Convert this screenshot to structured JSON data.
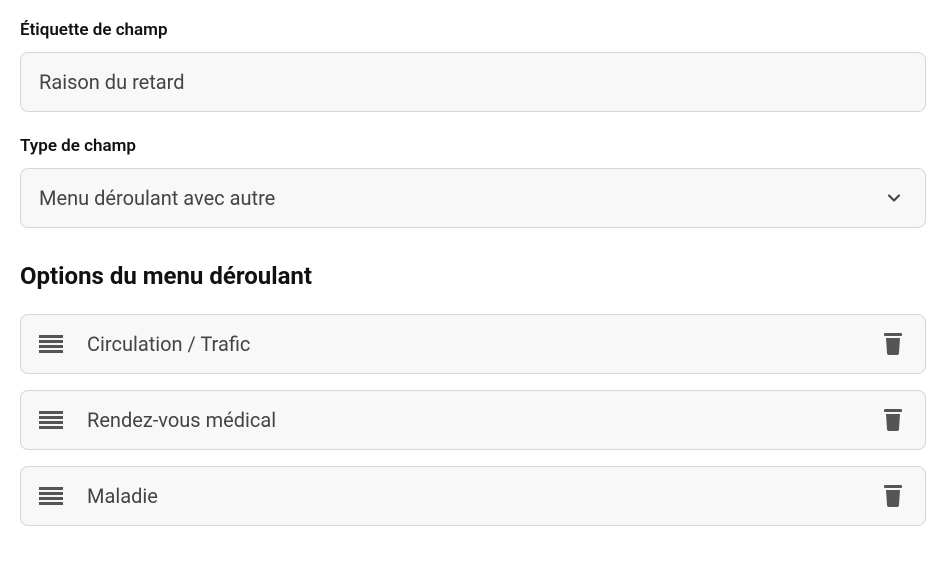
{
  "fieldLabel": {
    "label": "Étiquette de champ",
    "value": "Raison du retard"
  },
  "fieldType": {
    "label": "Type de champ",
    "value": "Menu déroulant avec autre"
  },
  "dropdownOptions": {
    "heading": "Options du menu déroulant",
    "items": [
      {
        "label": "Circulation / Trafic"
      },
      {
        "label": "Rendez-vous médical"
      },
      {
        "label": "Maladie"
      }
    ]
  }
}
